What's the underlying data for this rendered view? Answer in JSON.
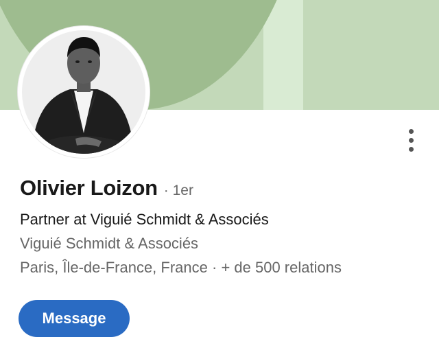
{
  "profile": {
    "name": "Olivier Loizon",
    "degree": "· 1er",
    "headline": "Partner at Viguié Schmidt & Associés",
    "company": "Viguié Schmidt & Associés",
    "location": "Paris, Île-de-France, France",
    "separator": " · ",
    "connections": "+ de 500 relations"
  },
  "actions": {
    "message_label": "Message",
    "more_icon": "more-vertical-icon"
  },
  "colors": {
    "banner_light": "#c3d9b9",
    "banner_dark": "#9ebc8f",
    "primary_button": "#2a6bc3",
    "text_primary": "#191919",
    "text_secondary": "#666666"
  }
}
